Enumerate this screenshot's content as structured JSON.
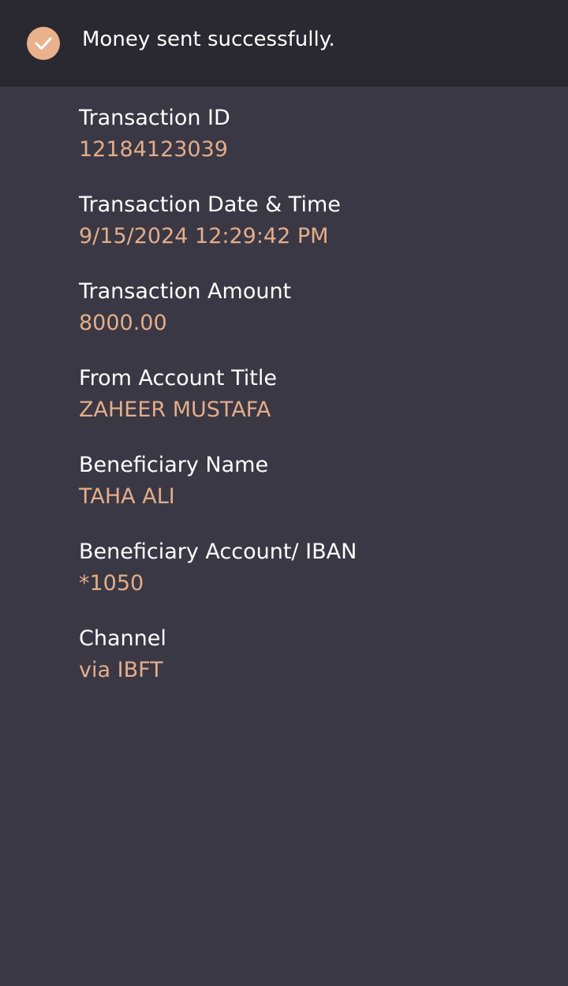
{
  "header": {
    "icon": "check-circle-icon",
    "message": "Money sent successfully.",
    "accent_color": "#e7b28c"
  },
  "details": [
    {
      "label": "Transaction ID",
      "value": "12184123039"
    },
    {
      "label": "Transaction Date & Time",
      "value": "9/15/2024 12:29:42 PM"
    },
    {
      "label": "Transaction Amount",
      "value": "8000.00"
    },
    {
      "label": "From Account Title",
      "value": "ZAHEER MUSTAFA"
    },
    {
      "label": "Beneficiary Name",
      "value": "TAHA ALI"
    },
    {
      "label": "Beneficiary Account/ IBAN",
      "value": "*1050"
    },
    {
      "label": "Channel",
      "value": "via IBFT"
    }
  ]
}
